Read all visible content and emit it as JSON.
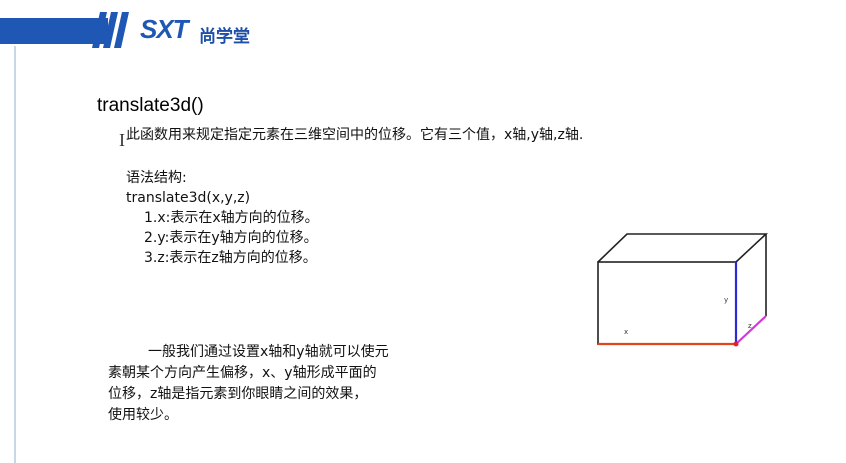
{
  "header": {
    "logo_mark": "SXT",
    "logo_cn": "尚学堂",
    "brand_color": "#1f57b4"
  },
  "slide": {
    "title": "translate3d()",
    "intro": "此函数用来规定指定元素在三维空间中的位移。它有三个值，x轴,y轴,z轴.",
    "syntax_label": "语法结构:",
    "syntax_code": "translate3d(x,y,z)",
    "params": [
      "1.x:表示在x轴方向的位移。",
      "2.y:表示在y轴方向的位移。",
      "3.z:表示在z轴方向的位移。"
    ],
    "summary_lines": [
      "一般我们通过设置x轴和y轴就可以使元",
      "素朝某个方向产生偏移，x、y轴形成平面的",
      "位移，z轴是指元素到你眼睛之间的效果，",
      "使用较少。"
    ]
  },
  "diagram": {
    "labels": {
      "x": "x",
      "y": "y",
      "z": "z"
    },
    "colors": {
      "x_axis": "#e0451b",
      "y_axis": "#2b2bd6",
      "z_axis": "#d13ad8",
      "origin": "#e0222b"
    }
  }
}
